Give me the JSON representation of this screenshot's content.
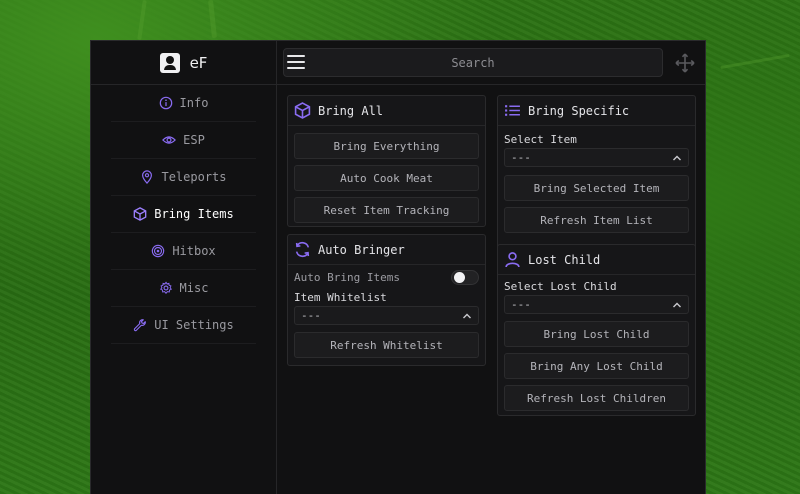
{
  "app": {
    "brand": "eF",
    "search_placeholder": "Search"
  },
  "colors": {
    "accent": "#7b5cf0",
    "background": "#111112",
    "panel": "#161618"
  },
  "sidebar": {
    "items": [
      {
        "label": "Info",
        "icon": "info-icon",
        "active": false
      },
      {
        "label": "ESP",
        "icon": "eye-icon",
        "active": false
      },
      {
        "label": "Teleports",
        "icon": "map-pin-icon",
        "active": false
      },
      {
        "label": "Bring Items",
        "icon": "cube-icon",
        "active": true
      },
      {
        "label": "Hitbox",
        "icon": "target-icon",
        "active": false
      },
      {
        "label": "Misc",
        "icon": "gear-icon",
        "active": false
      },
      {
        "label": "UI Settings",
        "icon": "wrench-icon",
        "active": false
      }
    ]
  },
  "panels": {
    "bring_all": {
      "title": "Bring All",
      "buttons": [
        "Bring Everything",
        "Auto Cook Meat",
        "Reset Item Tracking"
      ]
    },
    "auto_bringer": {
      "title": "Auto Bringer",
      "toggle_label": "Auto Bring Items",
      "toggle_on": false,
      "whitelist_label": "Item Whitelist",
      "whitelist_value": "---",
      "refresh_button": "Refresh Whitelist"
    },
    "bring_specific": {
      "title": "Bring Specific",
      "select_label": "Select Item",
      "select_value": "---",
      "buttons": [
        "Bring Selected Item",
        "Refresh Item List"
      ]
    },
    "lost_child": {
      "title": "Lost Child",
      "select_label": "Select Lost Child",
      "select_value": "---",
      "buttons": [
        "Bring Lost Child",
        "Bring Any Lost Child",
        "Refresh Lost Children"
      ]
    }
  }
}
